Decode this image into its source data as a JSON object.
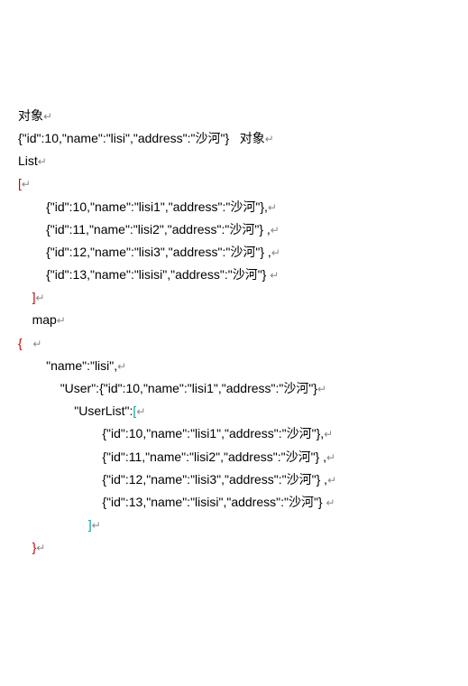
{
  "lines": [
    {
      "cls": "black",
      "ind": 0,
      "text": "对象",
      "marker": "↵"
    },
    {
      "cls": "black",
      "ind": 0,
      "text": "{\"id\":10,\"name\":\"lisi\",\"address\":\"沙河\"}   对象",
      "marker": "↵"
    },
    {
      "cls": "black",
      "ind": 0,
      "text": "List",
      "marker": "↵"
    },
    {
      "cls": "red",
      "ind": 0,
      "text": "[",
      "marker": "↵"
    },
    {
      "cls": "black",
      "ind": 2,
      "text": "{\"id\":10,\"name\":\"lisi1\",\"address\":\"沙河\"},",
      "marker": "↵"
    },
    {
      "cls": "black",
      "ind": 2,
      "text": "{\"id\":11,\"name\":\"lisi2\",\"address\":\"沙河\"} ,",
      "marker": "↵"
    },
    {
      "cls": "black",
      "ind": 2,
      "text": "{\"id\":12,\"name\":\"lisi3\",\"address\":\"沙河\"} ,",
      "marker": "↵"
    },
    {
      "cls": "black",
      "ind": 2,
      "text": "{\"id\":13,\"name\":\"lisisi\",\"address\":\"沙河\"} ",
      "marker": "↵"
    },
    {
      "cls": "red",
      "ind": 1,
      "text": "]",
      "marker": "↵"
    },
    {
      "cls": "black",
      "ind": 1,
      "text": "map",
      "marker": "↵"
    },
    {
      "cls": "red",
      "ind": 0,
      "text": "{   ",
      "marker": "↵"
    },
    {
      "cls": "black",
      "ind": 2,
      "text": "\"name\":\"lisi\",",
      "marker": "↵"
    },
    {
      "cls": "black",
      "ind": 3,
      "text": "\"User\":{\"id\":10,\"name\":\"lisi1\",\"address\":\"沙河\"}",
      "marker": "↵"
    },
    {
      "cls": "cyan",
      "ind": 4,
      "pre": "\"UserList\":",
      "brk": "[",
      "marker": "↵"
    },
    {
      "cls": "black",
      "ind": 6,
      "text": "{\"id\":10,\"name\":\"lisi1\",\"address\":\"沙河\"},",
      "marker": "↵"
    },
    {
      "cls": "black",
      "ind": 6,
      "text": "{\"id\":11,\"name\":\"lisi2\",\"address\":\"沙河\"} ,",
      "marker": "↵"
    },
    {
      "cls": "black",
      "ind": 6,
      "text": "{\"id\":12,\"name\":\"lisi3\",\"address\":\"沙河\"} ,",
      "marker": "↵"
    },
    {
      "cls": "black",
      "ind": 6,
      "text": "{\"id\":13,\"name\":\"lisisi\",\"address\":\"沙河\"} ",
      "marker": "↵"
    },
    {
      "cls": "cyan",
      "ind": 5,
      "brk": "]",
      "marker": "↵"
    },
    {
      "cls": "red",
      "ind": 1,
      "text": "}",
      "marker": "↵"
    }
  ]
}
